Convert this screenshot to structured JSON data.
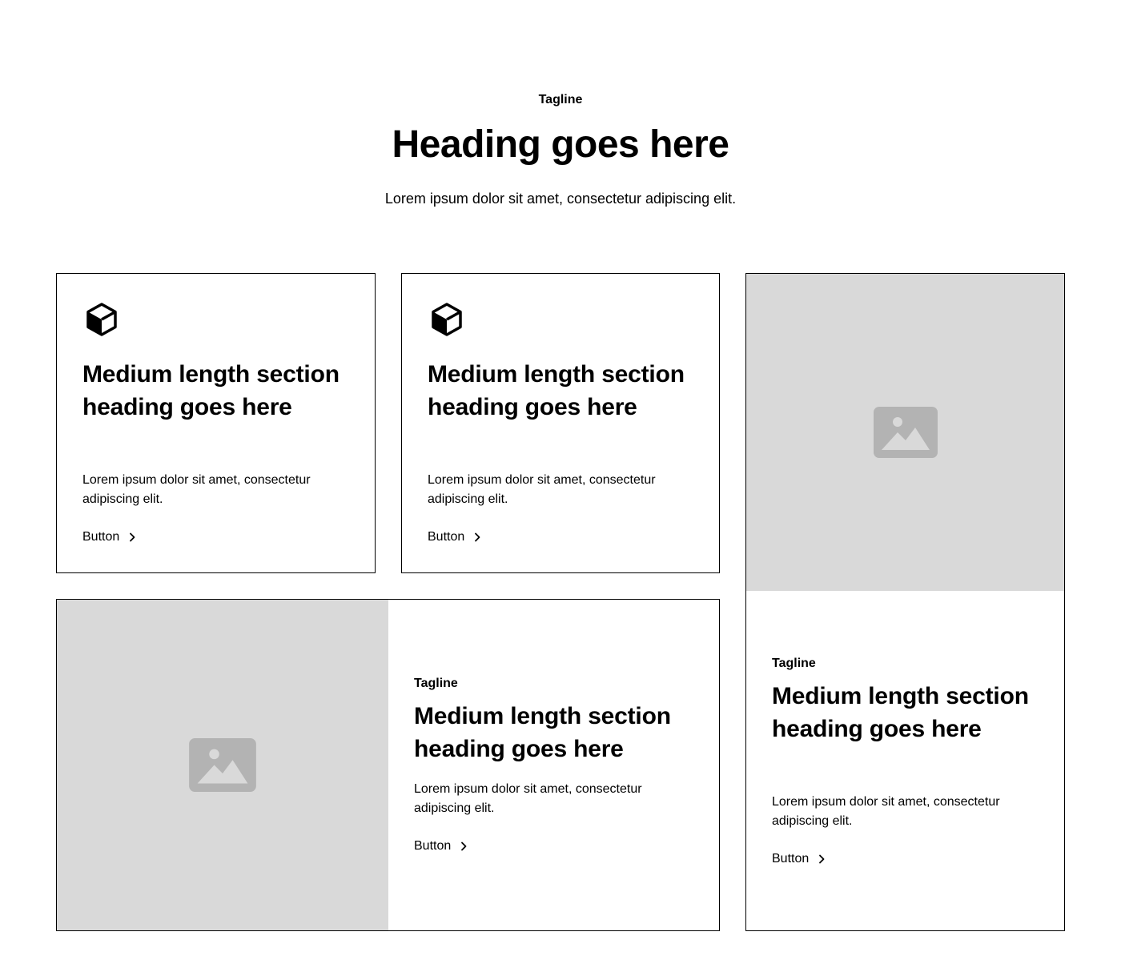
{
  "hero": {
    "tagline": "Tagline",
    "heading": "Heading goes here",
    "text": "Lorem ipsum dolor sit amet, consectetur adipiscing elit."
  },
  "cards": [
    {
      "icon": "cube-icon",
      "heading": "Medium length section heading goes here",
      "text": "Lorem ipsum dolor sit amet, consectetur adipiscing elit.",
      "button": "Button"
    },
    {
      "icon": "cube-icon",
      "heading": "Medium length section heading goes here",
      "text": "Lorem ipsum dolor sit amet, consectetur adipiscing elit.",
      "button": "Button"
    },
    {
      "image": "image-placeholder-icon",
      "tagline": "Tagline",
      "heading": "Medium length section heading goes here",
      "text": "Lorem ipsum dolor sit amet, consectetur adipiscing elit.",
      "button": "Button"
    },
    {
      "image": "image-placeholder-icon",
      "tagline": "Tagline",
      "heading": "Medium length section heading goes here",
      "text": "Lorem ipsum dolor sit amet, consectetur adipiscing elit.",
      "button": "Button"
    }
  ],
  "colors": {
    "placeholder_bg": "#d9d9d9",
    "placeholder_icon": "#b3b3b3",
    "border": "#000000"
  }
}
